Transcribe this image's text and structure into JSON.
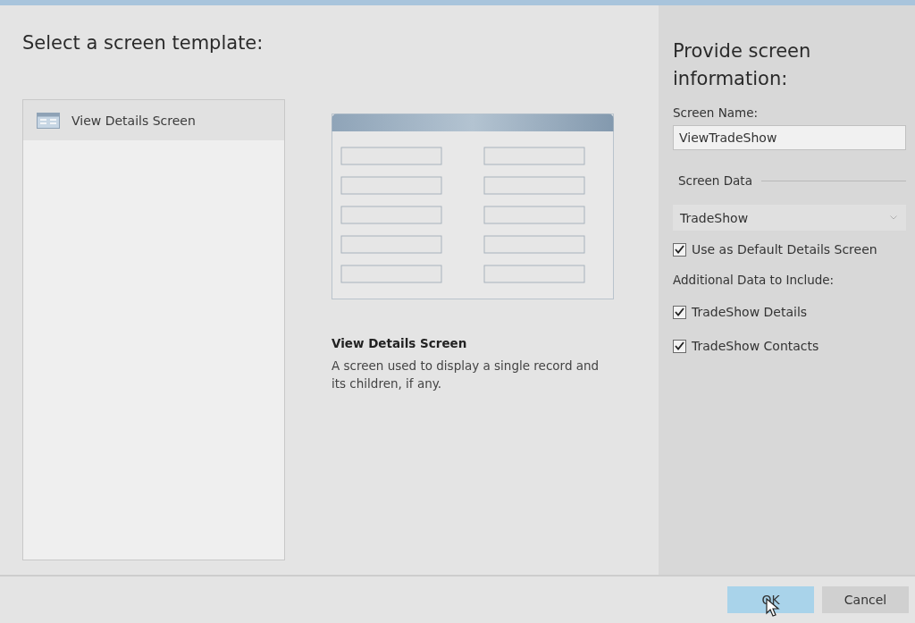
{
  "template_pane": {
    "heading": "Select a screen template:",
    "templates": [
      {
        "label": "View Details Screen",
        "selected": true
      }
    ]
  },
  "preview": {
    "title": "View Details Screen",
    "description": "A screen used to display a single record and its children, if any."
  },
  "info_pane": {
    "heading": "Provide screen information:",
    "screen_name_label": "Screen Name:",
    "screen_name": "ViewTradeShow",
    "screen_data_label": "Screen Data",
    "screen_data": "TradeShow",
    "default_option": {
      "label": "Use as Default Details Screen",
      "checked": true
    },
    "additional_label": "Additional Data to Include:",
    "additional": [
      {
        "label": "TradeShow Details",
        "checked": true
      },
      {
        "label": "TradeShow Contacts",
        "checked": true
      }
    ]
  },
  "buttons": [
    {
      "label": "OK",
      "kind": "primary"
    },
    {
      "label": "Cancel",
      "kind": "secondary"
    }
  ]
}
